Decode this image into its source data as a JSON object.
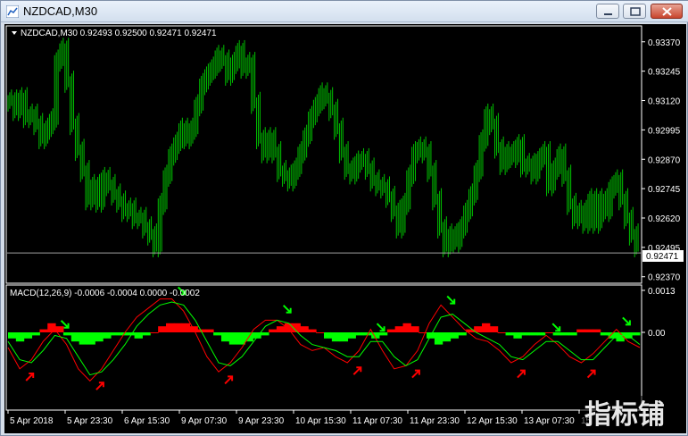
{
  "window": {
    "title": "NZDCAD,M30"
  },
  "price_panel": {
    "label": "NZDCAD,M30  0.92493 0.92500 0.92471 0.92471",
    "current_price": "0.92471",
    "ticks": [
      "0.93370",
      "0.93245",
      "0.93120",
      "0.92995",
      "0.92870",
      "0.92745",
      "0.92620",
      "0.92495",
      "0.92370"
    ]
  },
  "macd_panel": {
    "label": "MACD(12,26,9) -0.0006 -0.0004 0.0000 -0.0002",
    "ticks": [
      "0.0013",
      "0.00"
    ]
  },
  "time_axis": [
    "5 Apr 2018",
    "5 Apr 23:30",
    "6 Apr 15:30",
    "9 Apr 07:30",
    "9 Apr 23:30",
    "10 Apr 15:30",
    "11 Apr 07:30",
    "11 Apr 23:30",
    "12 Apr 15:30",
    "13 Apr 07:30",
    "15"
  ],
  "watermark": "指标铺",
  "colors": {
    "candles": "#00c000",
    "positive_hist": "#ff0000",
    "negative_hist": "#00ff00",
    "macd_line": "#ff0000",
    "signal_line": "#00ff00",
    "background": "#000000",
    "axis": "#ffffff"
  },
  "chart_data": [
    {
      "type": "bar",
      "title": "NZDCAD,M30",
      "ylim": [
        0.9235,
        0.9343
      ],
      "series": [
        {
          "values": [
            0.9312,
            0.9308,
            0.9313,
            0.9305,
            0.9306,
            0.9302,
            0.9296,
            0.93,
            0.9304,
            0.9329,
            0.9334,
            0.932,
            0.9302,
            0.9291,
            0.9282,
            0.927,
            0.9276,
            0.9269,
            0.9279,
            0.9276,
            0.9272,
            0.9269,
            0.9265,
            0.9266,
            0.9262,
            0.9262,
            0.9258,
            0.9255,
            0.925,
            0.9268,
            0.928,
            0.9289,
            0.9294,
            0.93,
            0.9296,
            0.93,
            0.931,
            0.9319,
            0.9323,
            0.9326,
            0.9331,
            0.9329,
            0.9323,
            0.9328,
            0.9333,
            0.9326,
            0.9328,
            0.9311,
            0.9296,
            0.929,
            0.9296,
            0.929,
            0.9282,
            0.928,
            0.9278,
            0.9283,
            0.929,
            0.9297,
            0.9305,
            0.931,
            0.9315,
            0.9313,
            0.9308,
            0.93,
            0.929,
            0.9283,
            0.9281,
            0.9286,
            0.9287,
            0.9283,
            0.9278,
            0.9276,
            0.9275,
            0.9271,
            0.9265,
            0.9258,
            0.9268,
            0.928,
            0.929,
            0.9292,
            0.929,
            0.9282,
            0.927,
            0.9258,
            0.925,
            0.9255,
            0.9252,
            0.9258,
            0.9265,
            0.9272,
            0.9282,
            0.9295,
            0.9306,
            0.9302,
            0.9292,
            0.9285,
            0.929,
            0.9288,
            0.9293,
            0.9284,
            0.9285,
            0.9281,
            0.9287,
            0.929,
            0.9276,
            0.9283,
            0.9289,
            0.928,
            0.9268,
            0.9262,
            0.9265,
            0.926,
            0.927,
            0.926,
            0.927,
            0.9265,
            0.9275,
            0.9278,
            0.927,
            0.9262,
            0.9255,
            0.925
          ]
        }
      ]
    },
    {
      "type": "bar",
      "title": "MACD(12,26,9)",
      "ylim": [
        -0.0025,
        0.0015
      ],
      "series": [
        {
          "name": "histogram",
          "values": [
            -0.0002,
            -0.0003,
            -0.0002,
            -0.0001,
            0.0001,
            0.0003,
            0.0002,
            -0.0001,
            -0.0003,
            -0.0004,
            -0.0004,
            -0.0003,
            -0.0002,
            -0.0001,
            -0.0001,
            -0.0001,
            -0.0002,
            -0.0001,
            0.0,
            0.0002,
            0.0003,
            0.0003,
            0.0003,
            0.0002,
            0.0001,
            0.0001,
            -0.0001,
            -0.0003,
            -0.0004,
            -0.0004,
            -0.0003,
            -0.0002,
            -0.0001,
            0.0001,
            0.0002,
            0.0003,
            0.0003,
            0.0002,
            0.0001,
            0.0,
            -0.0002,
            -0.0003,
            -0.0003,
            -0.0002,
            -0.0001,
            -0.0001,
            -0.0002,
            -0.0001,
            0.0001,
            0.0002,
            0.0003,
            0.0002,
            0.0,
            -0.0002,
            -0.0004,
            -0.0003,
            -0.0002,
            -0.0001,
            0.0001,
            0.0002,
            0.0003,
            0.0002,
            0.0,
            -0.0001,
            -0.0002,
            -0.0001,
            -0.0001,
            -0.0001,
            0.0,
            -0.0001,
            -0.0001,
            -0.0001,
            0.0001,
            0.0001,
            0.0001,
            -0.0001,
            -0.0002,
            -0.0003,
            -0.0002,
            -0.0001
          ]
        },
        {
          "name": "macd",
          "values": [
            -0.0005,
            -0.0012,
            -0.0009,
            -0.0003,
            0.0001,
            -0.0004,
            -0.0012,
            -0.0016,
            -0.0012,
            -0.0006,
            0.0,
            0.0005,
            0.0008,
            0.0011,
            0.0011,
            0.0007,
            0.0,
            -0.0008,
            -0.0013,
            -0.001,
            -0.0005,
            0.0001,
            0.0004,
            0.0004,
            0.0001,
            -0.0004,
            -0.0006,
            -0.0005,
            -0.0008,
            -0.001,
            -0.0006,
            0.0001,
            -0.0006,
            -0.0012,
            -0.0011,
            -0.0006,
            0.0003,
            0.0009,
            0.0005,
            0.0001,
            -0.0002,
            -0.0003,
            -0.0006,
            -0.001,
            -0.0008,
            -0.0004,
            -0.0001,
            -0.0004,
            -0.0008,
            -0.001,
            -0.0007,
            -0.0003,
            0.0001,
            -0.0003,
            -0.0005
          ]
        },
        {
          "name": "signal",
          "values": [
            -0.0003,
            -0.0009,
            -0.001,
            -0.0006,
            -0.0001,
            -0.0002,
            -0.0008,
            -0.0014,
            -0.0013,
            -0.0009,
            -0.0004,
            0.0002,
            0.0006,
            0.0009,
            0.001,
            0.0009,
            0.0004,
            -0.0003,
            -0.001,
            -0.0011,
            -0.0008,
            -0.0003,
            0.0002,
            0.0004,
            0.0003,
            -0.0001,
            -0.0004,
            -0.0005,
            -0.0006,
            -0.0008,
            -0.0008,
            -0.0003,
            -0.0003,
            -0.0008,
            -0.0011,
            -0.0009,
            -0.0002,
            0.0005,
            0.0006,
            0.0003,
            0.0,
            -0.0002,
            -0.0004,
            -0.0008,
            -0.0009,
            -0.0006,
            -0.0003,
            -0.0003,
            -0.0006,
            -0.0009,
            -0.0009,
            -0.0005,
            -0.0001,
            -0.0001,
            -0.0004
          ]
        }
      ]
    }
  ]
}
